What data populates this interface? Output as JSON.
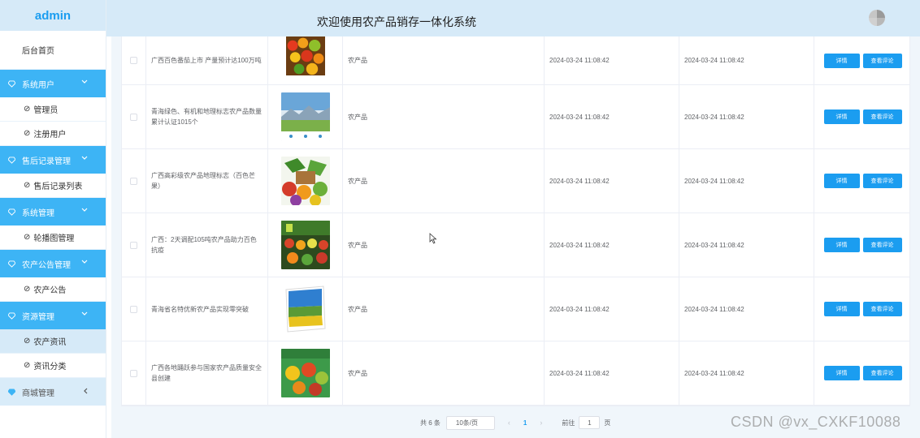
{
  "sidebar": {
    "logo": "admin",
    "home": "后台首页",
    "groups": [
      {
        "label": "系统用户",
        "items": [
          "管理员",
          "注册用户"
        ]
      },
      {
        "label": "售后记录管理",
        "items": [
          "售后记录列表"
        ]
      },
      {
        "label": "系统管理",
        "items": [
          "轮播图管理"
        ]
      },
      {
        "label": "农产公告管理",
        "items": [
          "农产公告"
        ]
      },
      {
        "label": "资源管理",
        "items": [
          "农产资讯",
          "资讯分类"
        ]
      },
      {
        "label": "商城管理",
        "items": []
      }
    ]
  },
  "header": {
    "title": "欢迎使用农产品销存一体化系统"
  },
  "table": {
    "rows": [
      {
        "title": "广西百色番茄上市 产量预计达100万吨",
        "category": "农产品",
        "time1": "2024-03-24 11:08:42",
        "time2": "2024-03-24 11:08:42"
      },
      {
        "title": "青海绿色、有机和地理标志农产品数量累计认证1015个",
        "category": "农产品",
        "time1": "2024-03-24 11:08:42",
        "time2": "2024-03-24 11:08:42"
      },
      {
        "title": "广西高彩级农产品地理标志（百色芒果）",
        "category": "农产品",
        "time1": "2024-03-24 11:08:42",
        "time2": "2024-03-24 11:08:42"
      },
      {
        "title": "广西：2天调配105吨农产品助力百色抗疫",
        "category": "农产品",
        "time1": "2024-03-24 11:08:42",
        "time2": "2024-03-24 11:08:42"
      },
      {
        "title": "青海省名特优新农产品实现零突破",
        "category": "农产品",
        "time1": "2024-03-24 11:08:42",
        "time2": "2024-03-24 11:08:42"
      },
      {
        "title": "广西各地踊跃参与国家农产品质量安全县创建",
        "category": "农产品",
        "time1": "2024-03-24 11:08:42",
        "time2": "2024-03-24 11:08:42"
      }
    ],
    "detail_label": "详情",
    "review_label": "查看评论"
  },
  "pagination": {
    "total": "共 6 条",
    "page_size": "10条/页",
    "prev": "‹",
    "current": "1",
    "next": "›",
    "goto_prefix": "前往",
    "goto_value": "1",
    "goto_suffix": "页"
  },
  "watermark": "CSDN @vx_CXKF10088",
  "colors": {
    "accent": "#1b9df0",
    "sidebar_active": "#3db4f5",
    "header_bg": "#d6eaf8"
  }
}
